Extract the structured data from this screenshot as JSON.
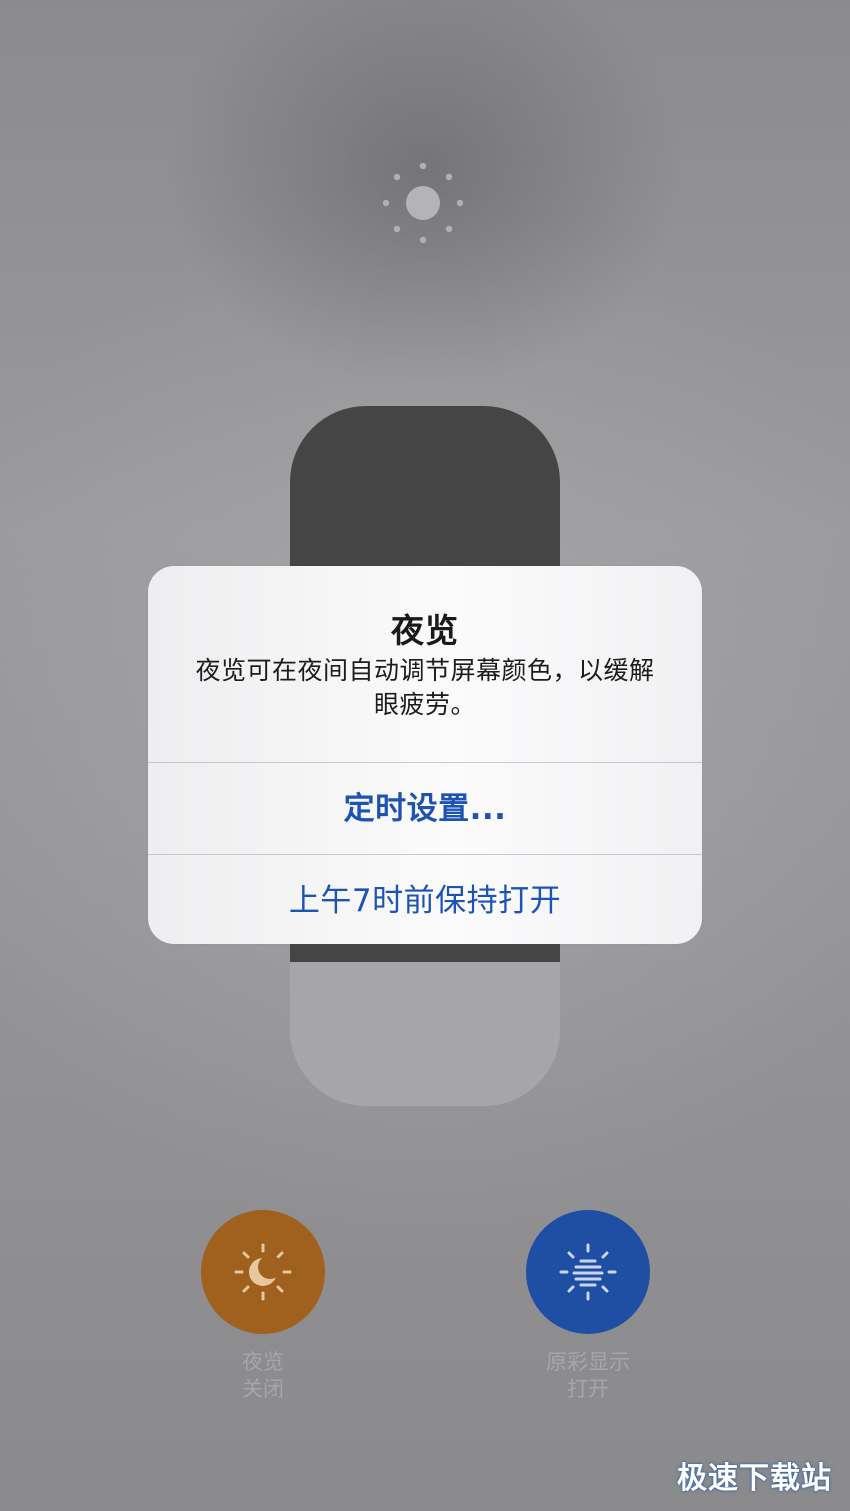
{
  "brightness_icon": "sun-icon",
  "alert": {
    "title": "夜览",
    "message": "夜览可在夜间自动调节屏幕颜色，以缓解眼疲劳。",
    "buttons": [
      {
        "label": "定时设置...",
        "style": "bold"
      },
      {
        "label": "上午7时前保持打开",
        "style": "regular"
      }
    ],
    "button_color": "#1d54b4"
  },
  "controls": {
    "night_shift": {
      "icon": "sun-moon-icon",
      "label_line1": "夜览",
      "label_line2": "关闭",
      "color": "#a0601e"
    },
    "true_tone": {
      "icon": "sun-stripes-icon",
      "label_line1": "原彩显示",
      "label_line2": "打开",
      "color": "#1f4ea5"
    }
  },
  "watermark": "极速下载站"
}
